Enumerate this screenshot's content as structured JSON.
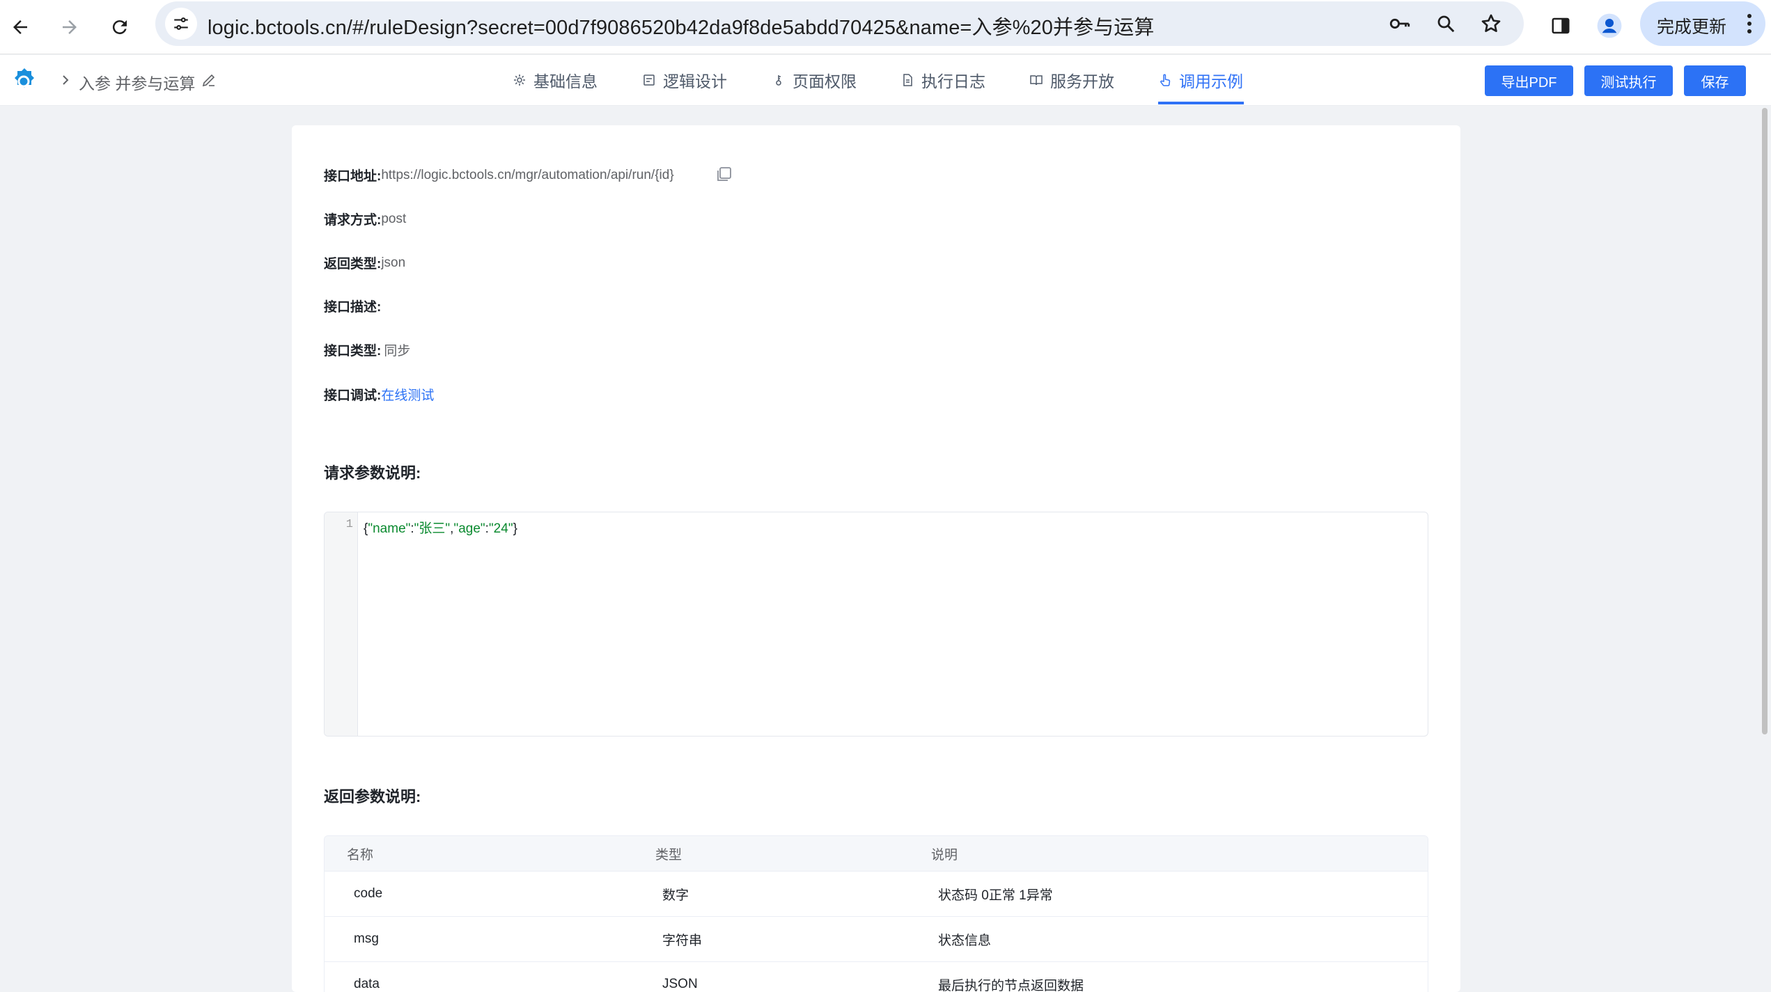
{
  "browser": {
    "url": "logic.bctools.cn/#/ruleDesign?secret=00d7f9086520b42da9f8de5abdd70425&name=入参%20并参与运算",
    "update_label": "完成更新"
  },
  "header": {
    "breadcrumb_title": "入参 并参与运算",
    "tabs": [
      {
        "label": "基础信息",
        "icon": "gear-icon"
      },
      {
        "label": "逻辑设计",
        "icon": "layout-icon"
      },
      {
        "label": "页面权限",
        "icon": "key-icon"
      },
      {
        "label": "执行日志",
        "icon": "document-icon"
      },
      {
        "label": "服务开放",
        "icon": "book-icon"
      },
      {
        "label": "调用示例",
        "icon": "hand-pointer-icon",
        "active": true
      }
    ],
    "buttons": {
      "export_pdf": "导出PDF",
      "test_run": "测试执行",
      "save": "保存"
    },
    "accent_color": "#2c72f5"
  },
  "api": {
    "address_label": "接口地址:",
    "address_value": "https://logic.bctools.cn/mgr/automation/api/run/{id}",
    "method_label": "请求方式:",
    "method_value": "post",
    "return_type_label": "返回类型:",
    "return_type_value": "json",
    "desc_label": "接口描述:",
    "desc_value": "",
    "kind_label": "接口类型:",
    "kind_value": "同步",
    "debug_label": "接口调试:",
    "debug_link": "在线测试"
  },
  "request": {
    "title": "请求参数说明:",
    "line_number": "1",
    "code_brace_open": "{",
    "code_key1": "\"name\"",
    "code_colon1": ":",
    "code_val1": "\"张三\"",
    "code_comma": ",",
    "code_key2": "\"age\"",
    "code_colon2": ":",
    "code_val2": "\"24\"",
    "code_brace_close": "}"
  },
  "response": {
    "title": "返回参数说明:",
    "columns": [
      "名称",
      "类型",
      "说明"
    ],
    "rows": [
      [
        "code",
        "数字",
        "状态码 0正常 1异常"
      ],
      [
        "msg",
        "字符串",
        "状态信息"
      ],
      [
        "data",
        "JSON",
        "最后执行的节点返回数据"
      ]
    ]
  }
}
